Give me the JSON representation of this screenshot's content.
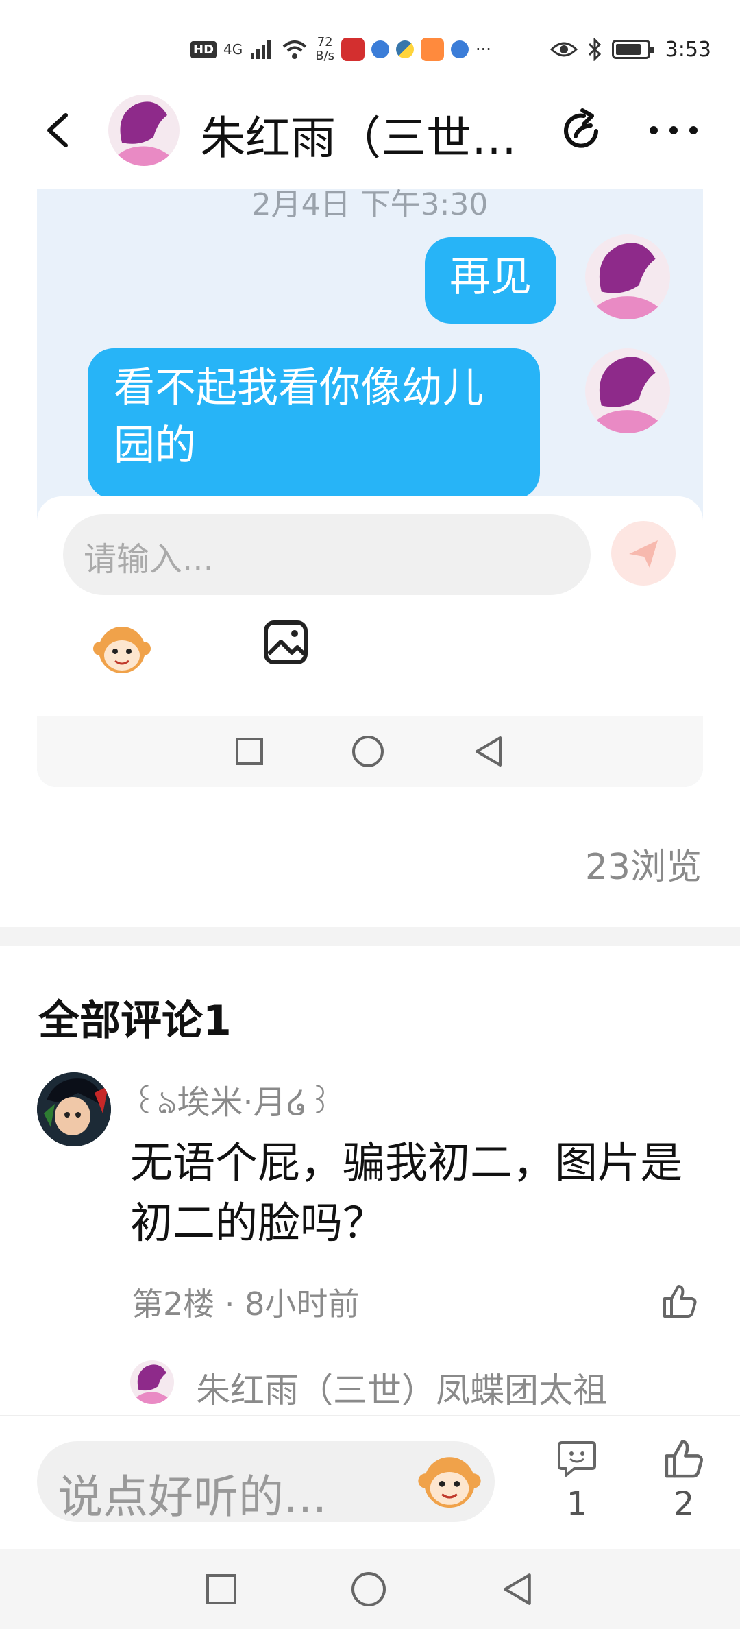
{
  "status_bar": {
    "hd": "HD",
    "network": "4G",
    "net_speed_value": "72",
    "net_speed_unit": "B/s",
    "more": "···",
    "time": "3:53"
  },
  "header": {
    "title": "朱红雨（三世…"
  },
  "screenshot": {
    "timestamp": "2月4日 下午3:30",
    "messages": [
      {
        "text": "再见"
      },
      {
        "text": "看不起我看你像幼儿园的"
      }
    ],
    "input_placeholder": "请输入..."
  },
  "post": {
    "views": "23浏览"
  },
  "comments": {
    "title": "全部评论1",
    "items": [
      {
        "author": "꒰ঌ埃米·月໒꒱",
        "text": "无语个屁，骗我初二，图片是初二的脸吗？",
        "meta": "第2楼 · 8小时前",
        "reply_author": "朱红雨（三世）凤蝶团太祖"
      }
    ]
  },
  "bottom_bar": {
    "input_placeholder": "说点好听的...",
    "comment_count": "1",
    "like_count": "2"
  },
  "colors": {
    "bubble_blue": "#27b4f7",
    "chat_bg": "#e9f1fa",
    "gray_text": "#8a8a8a"
  }
}
